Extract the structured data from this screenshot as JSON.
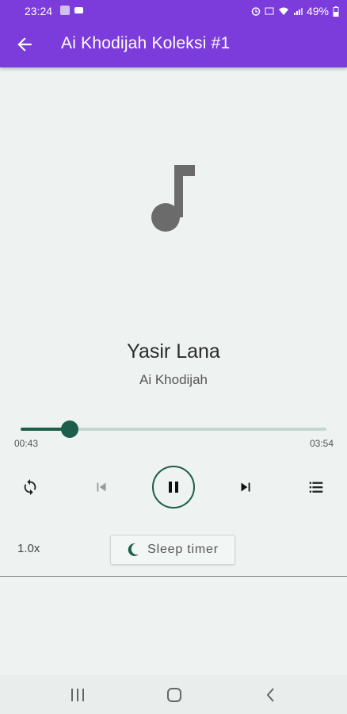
{
  "status_bar": {
    "time": "23:24",
    "battery": "49%"
  },
  "app_bar": {
    "title": "Ai Khodijah Koleksi #1"
  },
  "track": {
    "title": "Yasir Lana",
    "artist": "Ai Khodijah"
  },
  "progress": {
    "current": "00:43",
    "total": "03:54",
    "fraction": 0.16
  },
  "controls": {
    "repeat_icon": "repeat-icon",
    "previous_icon": "skip-previous-icon",
    "pause_icon": "pause-icon",
    "next_icon": "skip-next-icon",
    "playlist_icon": "playlist-icon"
  },
  "footer": {
    "speed": "1.0x",
    "sleep_label": "Sleep timer"
  },
  "colors": {
    "accent": "#7c3cdc",
    "primary": "#1b5e4a",
    "background": "#eef3f1"
  }
}
